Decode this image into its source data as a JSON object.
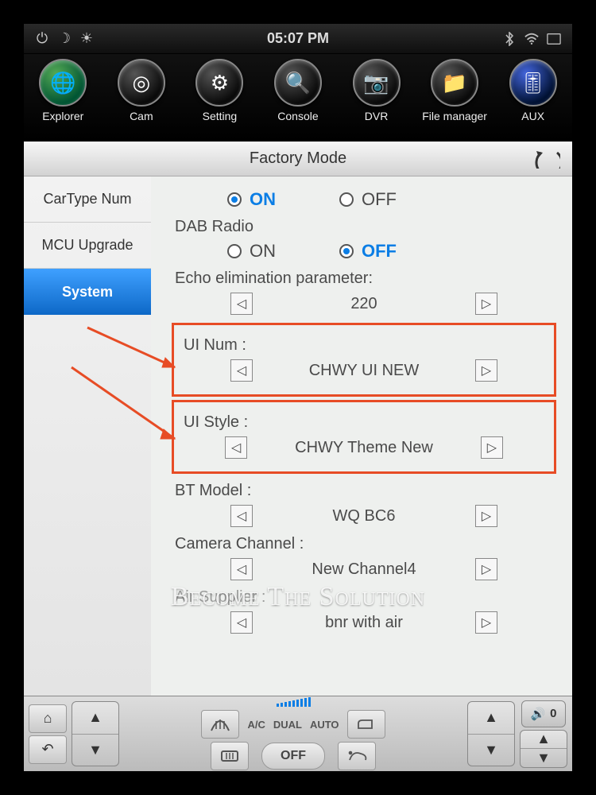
{
  "statusbar": {
    "time": "05:07 PM"
  },
  "dock": {
    "items": [
      {
        "label": "Explorer",
        "icon": "globe"
      },
      {
        "label": "Cam",
        "icon": "camera"
      },
      {
        "label": "Setting",
        "icon": "gear"
      },
      {
        "label": "Console",
        "icon": "wrench"
      },
      {
        "label": "DVR",
        "icon": "record"
      },
      {
        "label": "File manager",
        "icon": "folder"
      },
      {
        "label": "AUX",
        "icon": "aux"
      }
    ]
  },
  "titlebar": {
    "title": "Factory Mode"
  },
  "sidebar": {
    "items": [
      {
        "label": "CarType Num"
      },
      {
        "label": "MCU Upgrade"
      },
      {
        "label": "System",
        "active": true
      }
    ]
  },
  "content": {
    "row1": {
      "on": "ON",
      "off": "OFF",
      "selected": "ON"
    },
    "dab_label": "DAB Radio",
    "row2": {
      "on": "ON",
      "off": "OFF",
      "selected": "OFF"
    },
    "echo_label": "Echo elimination parameter:",
    "echo_value": "220",
    "ui_num_label": "UI Num :",
    "ui_num_value": "CHWY UI NEW",
    "ui_style_label": "UI Style :",
    "ui_style_value": "CHWY Theme New",
    "bt_label": "BT Model :",
    "bt_value": "WQ BC6",
    "camera_label": "Camera Channel :",
    "camera_value": "New Channel4",
    "air_label": "Air Supplier :",
    "air_value": "bnr with air"
  },
  "bottombar": {
    "ac": "A/C",
    "dual": "DUAL",
    "auto": "AUTO",
    "off": "OFF",
    "volume": "0"
  },
  "watermark": "Become The Solution"
}
